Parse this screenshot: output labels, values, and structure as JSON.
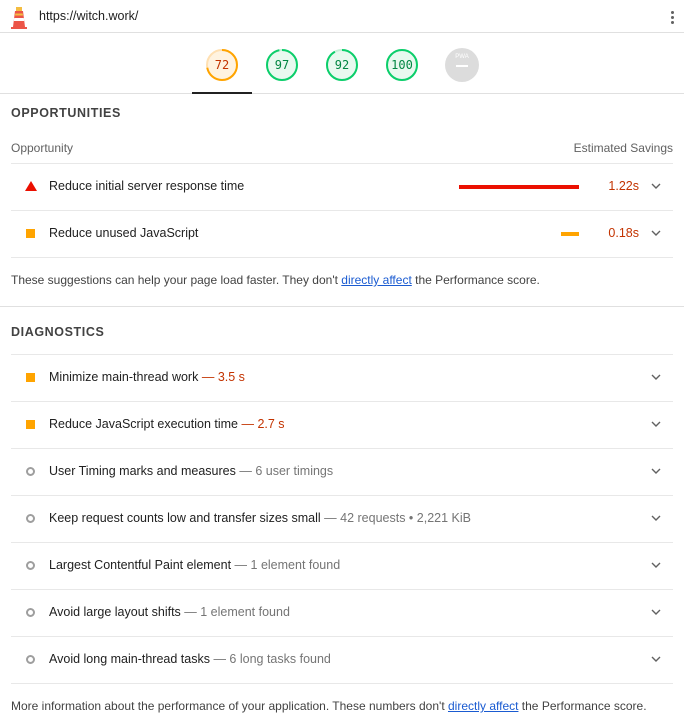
{
  "header": {
    "url": "https://witch.work/",
    "logo_icon": "lighthouse-logo-icon",
    "menu_icon": "kebab-menu-icon"
  },
  "scores": [
    {
      "value": "72",
      "score": 0.72,
      "status": "average",
      "color": "#ffa400"
    },
    {
      "value": "97",
      "score": 0.97,
      "status": "pass",
      "color": "#0cce6b"
    },
    {
      "value": "92",
      "score": 0.92,
      "status": "pass",
      "color": "#0cce6b"
    },
    {
      "value": "100",
      "score": 1.0,
      "status": "pass",
      "color": "#0cce6b"
    },
    {
      "value": "PWA",
      "status": "na",
      "color": "#dcdcdc"
    }
  ],
  "opportunities": {
    "title": "OPPORTUNITIES",
    "col_left": "Opportunity",
    "col_right": "Estimated Savings",
    "items": [
      {
        "title": "Reduce initial server response time",
        "saving": "1.22s",
        "bar_fraction": 1.0,
        "bar_color": "#eb0f00",
        "icon": "fail-triangle-icon"
      },
      {
        "title": "Reduce unused JavaScript",
        "saving": "0.18s",
        "bar_fraction": 0.15,
        "bar_color": "#ffa400",
        "icon": "average-square-icon"
      }
    ],
    "note_before": "These suggestions can help your page load faster. They don't ",
    "note_link": "directly affect",
    "note_after": " the Performance score."
  },
  "diagnostics": {
    "title": "DIAGNOSTICS",
    "items": [
      {
        "title": "Minimize main-thread work",
        "sep": " — ",
        "display": "3.5 s",
        "status": "average",
        "icon": "average-square-icon"
      },
      {
        "title": "Reduce JavaScript execution time",
        "sep": " — ",
        "display": "2.7 s",
        "status": "average",
        "icon": "average-square-icon"
      },
      {
        "title": "User Timing marks and measures",
        "sep": " — ",
        "display": "6 user timings",
        "status": "info",
        "icon": "info-circle-icon"
      },
      {
        "title": "Keep request counts low and transfer sizes small",
        "sep": " — ",
        "display": "42 requests • 2,221 KiB",
        "status": "info",
        "icon": "info-circle-icon"
      },
      {
        "title": "Largest Contentful Paint element",
        "sep": " — ",
        "display": "1 element found",
        "status": "info",
        "icon": "info-circle-icon"
      },
      {
        "title": "Avoid large layout shifts",
        "sep": " — ",
        "display": "1 element found",
        "status": "info",
        "icon": "info-circle-icon"
      },
      {
        "title": "Avoid long main-thread tasks",
        "sep": " — ",
        "display": "6 long tasks found",
        "status": "info",
        "icon": "info-circle-icon"
      }
    ],
    "note_before": "More information about the performance of your application. These numbers don't ",
    "note_link": "directly affect",
    "note_after": " the Performance score."
  },
  "colors": {
    "fail": "#eb0f00",
    "average": "#ffa400",
    "pass": "#0cce6b",
    "link": "#1a5bd1"
  }
}
